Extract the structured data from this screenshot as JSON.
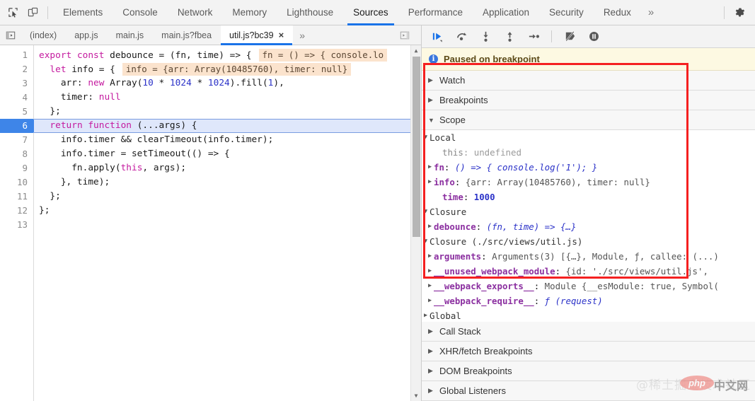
{
  "toolbar": {
    "inspect_icon": "inspect-element-icon",
    "device_icon": "device-toolbar-icon",
    "gear_icon": "settings-gear-icon",
    "overflow_label": "»"
  },
  "main_tabs": [
    {
      "label": "Elements",
      "active": false
    },
    {
      "label": "Console",
      "active": false
    },
    {
      "label": "Network",
      "active": false
    },
    {
      "label": "Memory",
      "active": false
    },
    {
      "label": "Lighthouse",
      "active": false
    },
    {
      "label": "Sources",
      "active": true
    },
    {
      "label": "Performance",
      "active": false
    },
    {
      "label": "Application",
      "active": false
    },
    {
      "label": "Security",
      "active": false
    },
    {
      "label": "Redux",
      "active": false
    }
  ],
  "file_tabs": {
    "navigator_icon": "show-navigator-icon",
    "split_icon": "show-debugger-icon",
    "overflow_label": "»",
    "items": [
      {
        "label": "(index)",
        "active": false,
        "closable": false
      },
      {
        "label": "app.js",
        "active": false,
        "closable": false
      },
      {
        "label": "main.js",
        "active": false,
        "closable": false
      },
      {
        "label": "main.js?fbea",
        "active": false,
        "closable": false
      },
      {
        "label": "util.js?bc39",
        "active": true,
        "closable": true,
        "close_label": "×"
      }
    ]
  },
  "editor": {
    "line_numbers": [
      "1",
      "2",
      "3",
      "4",
      "5",
      "6",
      "7",
      "8",
      "9",
      "10",
      "11",
      "12",
      "13"
    ],
    "breakpoint_line": 6,
    "current_line": 6,
    "inline_hints": [
      {
        "line": 1,
        "text": "fn = () => { console.lo"
      },
      {
        "line": 2,
        "text": "info = {arr: Array(10485760), timer: null}"
      }
    ],
    "lines": [
      {
        "n": 1,
        "tokens": [
          {
            "t": "export ",
            "c": "kw"
          },
          {
            "t": "const ",
            "c": "kw"
          },
          {
            "t": "debounce = (fn, time) => {",
            "c": "plain"
          }
        ]
      },
      {
        "n": 2,
        "tokens": [
          {
            "t": "  ",
            "c": "plain"
          },
          {
            "t": "let ",
            "c": "kw"
          },
          {
            "t": "info = {",
            "c": "plain"
          }
        ]
      },
      {
        "n": 3,
        "tokens": [
          {
            "t": "    arr: ",
            "c": "plain"
          },
          {
            "t": "new ",
            "c": "kw"
          },
          {
            "t": "Array(",
            "c": "plain"
          },
          {
            "t": "10",
            "c": "num"
          },
          {
            "t": " * ",
            "c": "plain"
          },
          {
            "t": "1024",
            "c": "num"
          },
          {
            "t": " * ",
            "c": "plain"
          },
          {
            "t": "1024",
            "c": "num"
          },
          {
            "t": ").fill(",
            "c": "plain"
          },
          {
            "t": "1",
            "c": "num"
          },
          {
            "t": "),",
            "c": "plain"
          }
        ]
      },
      {
        "n": 4,
        "tokens": [
          {
            "t": "    timer: ",
            "c": "plain"
          },
          {
            "t": "null",
            "c": "kw"
          }
        ]
      },
      {
        "n": 5,
        "tokens": [
          {
            "t": "  };",
            "c": "plain"
          }
        ]
      },
      {
        "n": 6,
        "tokens": [
          {
            "t": "  ",
            "c": "plain"
          },
          {
            "t": "return function ",
            "c": "kw"
          },
          {
            "t": "(...args) {",
            "c": "plain"
          }
        ]
      },
      {
        "n": 7,
        "tokens": [
          {
            "t": "    info.timer && clearTimeout(info.timer);",
            "c": "plain"
          }
        ]
      },
      {
        "n": 8,
        "tokens": [
          {
            "t": "    info.timer = setTimeout(() => {",
            "c": "plain"
          }
        ]
      },
      {
        "n": 9,
        "tokens": [
          {
            "t": "      fn.apply(",
            "c": "plain"
          },
          {
            "t": "this",
            "c": "kw"
          },
          {
            "t": ", args);",
            "c": "plain"
          }
        ]
      },
      {
        "n": 10,
        "tokens": [
          {
            "t": "    }, time);",
            "c": "plain"
          }
        ]
      },
      {
        "n": 11,
        "tokens": [
          {
            "t": "  };",
            "c": "plain"
          }
        ]
      },
      {
        "n": 12,
        "tokens": [
          {
            "t": "};",
            "c": "plain"
          }
        ]
      },
      {
        "n": 13,
        "tokens": [
          {
            "t": "",
            "c": "plain"
          }
        ]
      }
    ]
  },
  "debugger": {
    "controls": [
      {
        "name": "resume-script-execution",
        "icon": "resume-icon"
      },
      {
        "name": "step-over-next-function-call",
        "icon": "step-over-icon"
      },
      {
        "name": "step-into-next-function-call",
        "icon": "step-into-icon"
      },
      {
        "name": "step-out-of-current-function",
        "icon": "step-out-icon"
      },
      {
        "name": "step",
        "icon": "step-icon"
      },
      {
        "name": "deactivate-breakpoints",
        "icon": "deactivate-breakpoints-icon"
      },
      {
        "name": "pause-on-exceptions",
        "icon": "pause-on-exceptions-icon"
      }
    ],
    "status": {
      "icon": "info-icon",
      "text": "Paused on breakpoint"
    },
    "sections_top": [
      {
        "label": "Watch",
        "expanded": false,
        "tri": "▶"
      },
      {
        "label": "Breakpoints",
        "expanded": false,
        "tri": "▶"
      }
    ],
    "scope": {
      "label": "Scope",
      "tri": "▼",
      "groups": [
        {
          "title": "Local",
          "tri": "▼",
          "indent": 0,
          "rows": [
            {
              "expandable": false,
              "name": "this",
              "name_class": "pname-dim",
              "sep": ": ",
              "value": "undefined",
              "value_class": "pval-dim",
              "indent": 2
            },
            {
              "expandable": true,
              "name": "fn",
              "name_class": "pname",
              "sep": ": ",
              "value": "() => { console.log('1'); }",
              "value_class": "pval-fn",
              "indent": 1
            },
            {
              "expandable": true,
              "name": "info",
              "name_class": "pname",
              "sep": ": ",
              "value": "{arr: Array(10485760), timer: null}",
              "value_class": "pval-obj",
              "indent": 1
            },
            {
              "expandable": false,
              "name": "time",
              "name_class": "pname",
              "sep": ": ",
              "value": "1000",
              "value_class": "pval-num",
              "indent": 2
            }
          ]
        },
        {
          "title": "Closure",
          "tri": "▼",
          "indent": 0,
          "rows": [
            {
              "expandable": true,
              "name": "debounce",
              "name_class": "pname",
              "sep": ": ",
              "value": "(fn, time) => {…}",
              "value_class": "pval-fn",
              "indent": 1
            }
          ]
        },
        {
          "title": "Closure (./src/views/util.js)",
          "tri": "▼",
          "indent": 0,
          "rows": [
            {
              "expandable": true,
              "name": "arguments",
              "name_class": "pname",
              "sep": ": ",
              "value": "Arguments(3) [{…}, Module, ƒ, callee: (...)",
              "value_class": "pval-obj",
              "indent": 1
            },
            {
              "expandable": true,
              "name": "__unused_webpack_module",
              "name_class": "pname",
              "sep": ": ",
              "value": "{id: './src/views/util.js', ",
              "value_class": "pval-obj",
              "indent": 1
            },
            {
              "expandable": true,
              "name": "__webpack_exports__",
              "name_class": "pname",
              "sep": ": ",
              "value": "Module {__esModule: true, Symbol(",
              "value_class": "pval-obj",
              "indent": 1
            },
            {
              "expandable": true,
              "name": "__webpack_require__",
              "name_class": "pname",
              "sep": ": ",
              "value": "ƒ (request)",
              "value_class": "pval-fn",
              "indent": 1
            }
          ]
        },
        {
          "title": "Global",
          "tri": "▶",
          "indent": 0,
          "rows": []
        }
      ]
    },
    "sections_bottom": [
      {
        "label": "Call Stack",
        "tri": "▶"
      },
      {
        "label": "XHR/fetch Breakpoints",
        "tri": "▶"
      },
      {
        "label": "DOM Breakpoints",
        "tri": "▶"
      },
      {
        "label": "Global Listeners",
        "tri": "▶"
      }
    ]
  },
  "annotation": {
    "highlight_color": "#f52020"
  },
  "watermark": {
    "text": "@稀土掘金技术社区",
    "badge": "php",
    "badge_suffix": "中文网"
  }
}
